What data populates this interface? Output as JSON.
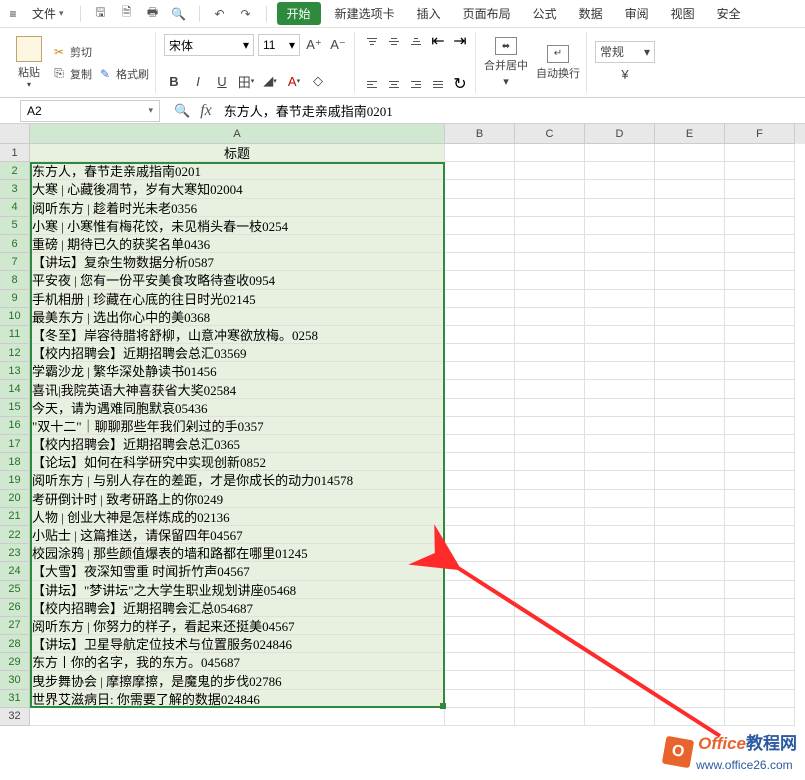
{
  "menu": {
    "file": "文件",
    "tabs": [
      "开始",
      "新建选项卡",
      "插入",
      "页面布局",
      "公式",
      "数据",
      "审阅",
      "视图",
      "安全"
    ]
  },
  "toolbar": {
    "paste": "粘贴",
    "cut": "剪切",
    "copy": "复制",
    "format_painter": "格式刷",
    "font_name": "宋体",
    "font_size": "11",
    "merge": "合并居中",
    "wrap": "自动换行",
    "number_format": "常规"
  },
  "addressbar": {
    "cell": "A2"
  },
  "formula": "东方人，春节走亲戚指南0201",
  "columns": [
    "A",
    "B",
    "C",
    "D",
    "E",
    "F"
  ],
  "header_row_label": "标题",
  "rows": [
    "东方人，春节走亲戚指南0201",
    "大寒 | 心藏後凋节，岁有大寒知02004",
    "阅听东方 | 趁着时光未老0356",
    "小寒 | 小寒惟有梅花饺，未见梢头春一枝0254",
    "重磅 | 期待已久的获奖名单0436",
    "【讲坛】复杂生物数据分析0587",
    "平安夜 | 您有一份平安美食攻略待查收0954",
    "手机相册 | 珍藏在心底的往日时光02145",
    "最美东方 | 选出你心中的美0368",
    "【冬至】岸容待腊将舒柳，山意冲寒欲放梅。0258",
    "【校内招聘会】近期招聘会总汇03569",
    "学霸沙龙 | 繁华深处静读书01456",
    "喜讯|我院英语大神喜获省大奖02584",
    "今天，请为遇难同胞默哀05436",
    "\"双十二\"｜聊聊那些年我们剁过的手0357",
    "【校内招聘会】近期招聘会总汇0365",
    "【论坛】如何在科学研究中实现创新0852",
    "阅听东方 | 与别人存在的差距，才是你成长的动力014578",
    "考研倒计时 | 致考研路上的你0249",
    "人物 | 创业大神是怎样炼成的02136",
    "小贴士 | 这篇推送，请保留四年04567",
    "校园涂鸦 | 那些颜值爆表的墙和路都在哪里01245",
    "【大雪】夜深知雪重 时闻折竹声04567",
    "【讲坛】\"梦讲坛\"之大学生职业规划讲座05468",
    "【校内招聘会】近期招聘会汇总054687",
    "阅听东方 | 你努力的样子，看起来还挺美04567",
    "【讲坛】卫星导航定位技术与位置服务024846",
    "东方丨你的名字，我的东方。045687",
    "曳步舞协会 | 摩擦摩擦，是魔鬼的步伐02786",
    "世界艾滋病日: 你需要了解的数据024846"
  ],
  "watermark": {
    "brand1": "Office",
    "brand2": "教程网",
    "url": "www.office26.com"
  }
}
